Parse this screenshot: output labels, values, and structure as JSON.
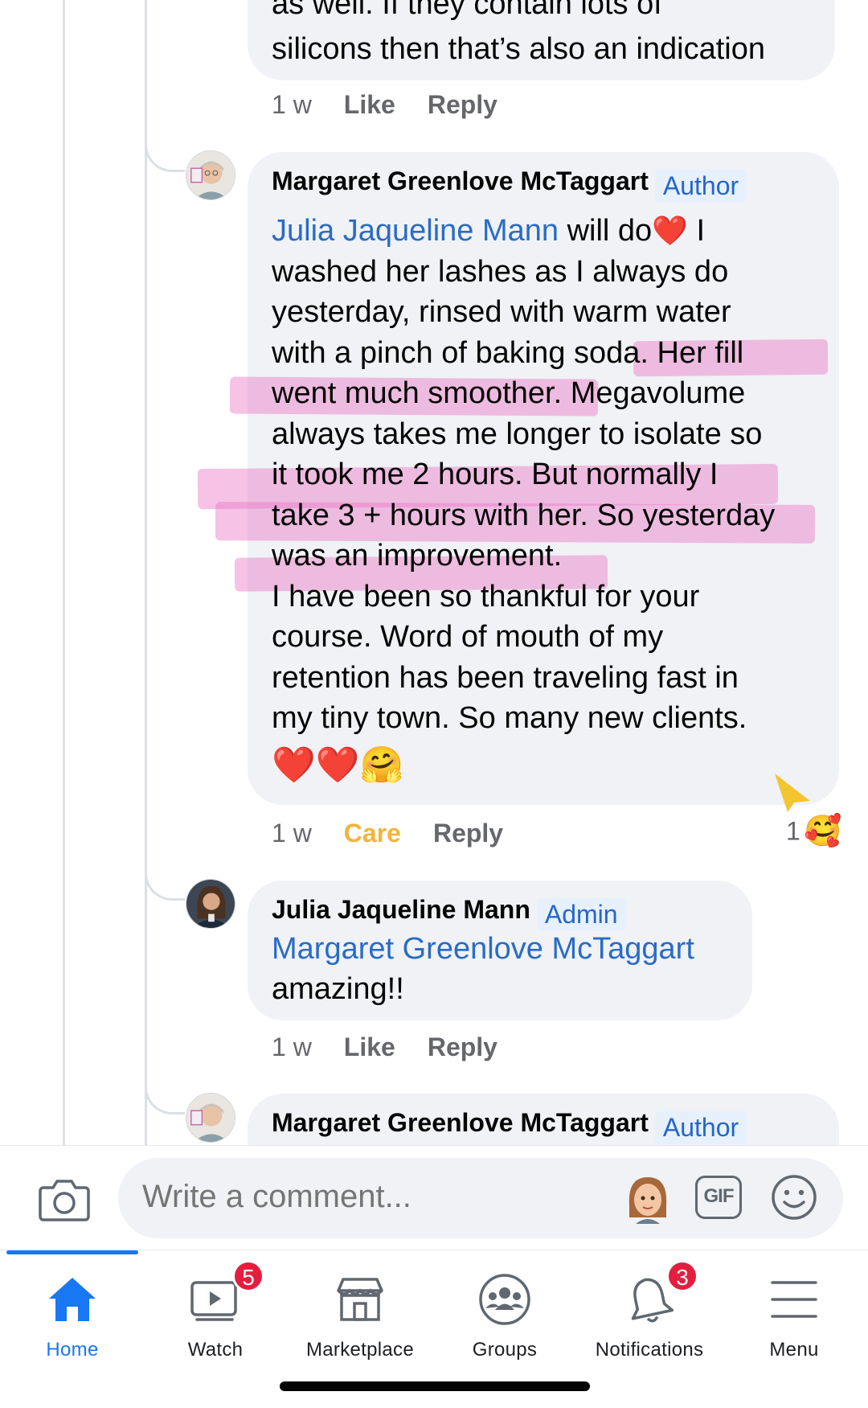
{
  "previous_comment": {
    "line1": "as well.  If they contain lots of",
    "line2": "silicons then that’s also an indication",
    "time": "1 w",
    "like": "Like",
    "reply": "Reply"
  },
  "comment1": {
    "author": "Margaret Greenlove McTaggart",
    "badge": "Author",
    "mention": "Julia Jaqueline Mann",
    "line1_rest": " will do",
    "line1_end": " I",
    "lines": [
      "washed her lashes as I always do",
      "yesterday, rinsed with warm water",
      "with a pinch of baking soda. Her fill",
      "went much smoother. Megavolume",
      "always takes me longer to isolate so",
      "it took me 2 hours. But normally I",
      "take 3 + hours with her. So yesterday",
      "was an improvement.",
      "I have been so thankful for your",
      "course. Word of mouth of my",
      "retention has been traveling fast in",
      "my tiny town. So many new clients."
    ],
    "emoji": "❤️❤️🤗",
    "heart_emoji": "❤️",
    "time": "1 w",
    "reaction_label": "Care",
    "reply": "Reply",
    "reaction_count": "1",
    "reaction_emoji": "🥰"
  },
  "comment2": {
    "author": "Julia Jaqueline Mann",
    "badge": "Admin",
    "mention": "Margaret Greenlove McTaggart",
    "text": "amazing!!",
    "time": "1 w",
    "like": "Like",
    "reply": "Reply"
  },
  "comment3": {
    "author": "Margaret Greenlove McTaggart",
    "badge": "Author"
  },
  "composer": {
    "placeholder": "Write a comment...",
    "gif_label": "GIF"
  },
  "tabs": [
    {
      "label": "Home",
      "badge": ""
    },
    {
      "label": "Watch",
      "badge": "5"
    },
    {
      "label": "Marketplace",
      "badge": ""
    },
    {
      "label": "Groups",
      "badge": ""
    },
    {
      "label": "Notifications",
      "badge": "3"
    },
    {
      "label": "Menu",
      "badge": ""
    }
  ],
  "colors": {
    "accent": "#1877f2",
    "mention": "#2a6bc7",
    "care": "#f2b43b",
    "highlight": "#ec78c8",
    "badge_red": "#e41e3f"
  }
}
